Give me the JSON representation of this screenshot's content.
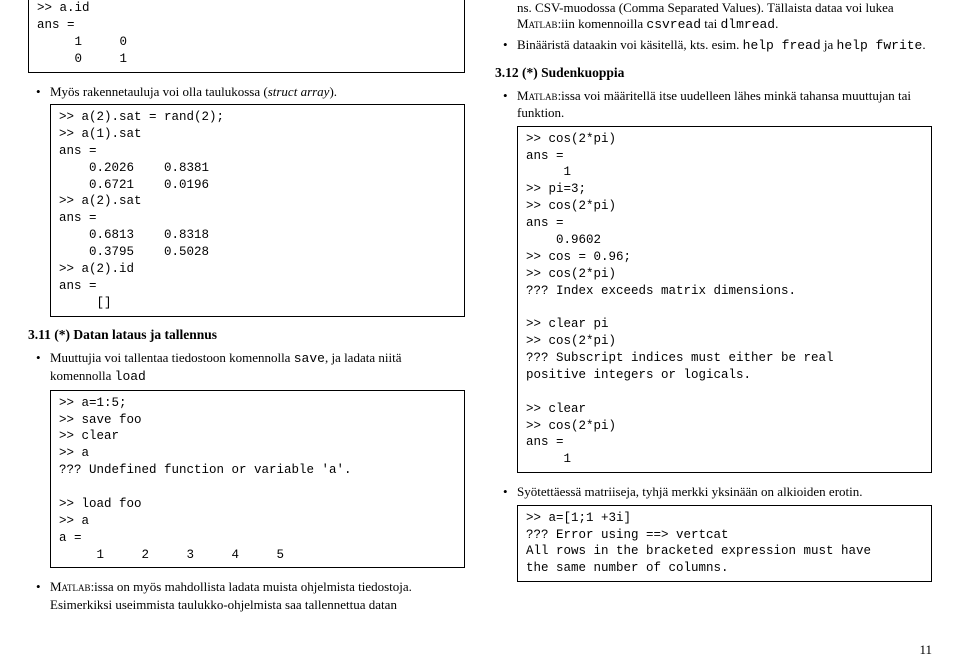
{
  "left": {
    "code1": ">> a.id\nans =\n     1     0\n     0     1",
    "bullet1_pre": "Myös rakennetauluja voi olla taulukossa (",
    "bullet1_it": "struct array",
    "bullet1_post": ").",
    "code2": ">> a(2).sat = rand(2);\n>> a(1).sat\nans =\n    0.2026    0.8381\n    0.6721    0.0196\n>> a(2).sat\nans =\n    0.6813    0.8318\n    0.3795    0.5028\n>> a(2).id\nans =\n     []",
    "sec311": "3.11  (*) Datan lataus ja tallennus",
    "bullet2_pre": "Muuttujia voi tallentaa tiedostoon komennolla ",
    "bullet2_save": "save",
    "bullet2_mid": ", ja ladata niitä komennolla ",
    "bullet2_load": "load",
    "code3": ">> a=1:5;\n>> save foo\n>> clear\n>> a\n??? Undefined function or variable 'a'.\n\n>> load foo\n>> a\na =\n     1     2     3     4     5",
    "bullet3_sc": "Matlab",
    "bullet3_rest": ":issa on myös mahdollista ladata muista ohjelmista tiedostoja. Esimerkiksi useimmista taulukko-ohjelmista saa tallennettua datan"
  },
  "right": {
    "cont1_pre": "ns. CSV-muodossa (Comma Separated Values). Tällaista dataa voi lukea ",
    "cont1_sc": "Matlab",
    "cont1_mid": ":iin komennoilla ",
    "cont1_csvread": "csvread",
    "cont1_tai": " tai ",
    "cont1_dlmread": "dlmread",
    "cont1_dot": ".",
    "bullet_bin_pre": "Binääristä dataakin voi käsitellä, kts. esim. ",
    "bullet_bin_help1": "help fread",
    "bullet_bin_ja": " ja ",
    "bullet_bin_help2": "help fwrite",
    "bullet_bin_dot": ".",
    "sec312": "3.12  (*) Sudenkuoppia",
    "bullet4_sc": "Matlab",
    "bullet4_rest": ":issa voi määritellä itse uudelleen lähes minkä tahansa muuttujan tai funktion.",
    "code4": ">> cos(2*pi)\nans =\n     1\n>> pi=3;\n>> cos(2*pi)\nans =\n    0.9602\n>> cos = 0.96;\n>> cos(2*pi)\n??? Index exceeds matrix dimensions.\n\n>> clear pi\n>> cos(2*pi)\n??? Subscript indices must either be real\npositive integers or logicals.\n\n>> clear\n>> cos(2*pi)\nans =\n     1",
    "bullet5": "Syötettäessä matriiseja, tyhjä merkki yksinään on alkioiden erotin.",
    "code5": ">> a=[1;1 +3i]\n??? Error using ==> vertcat\nAll rows in the bracketed expression must have\nthe same number of columns."
  },
  "pagenum": "11"
}
